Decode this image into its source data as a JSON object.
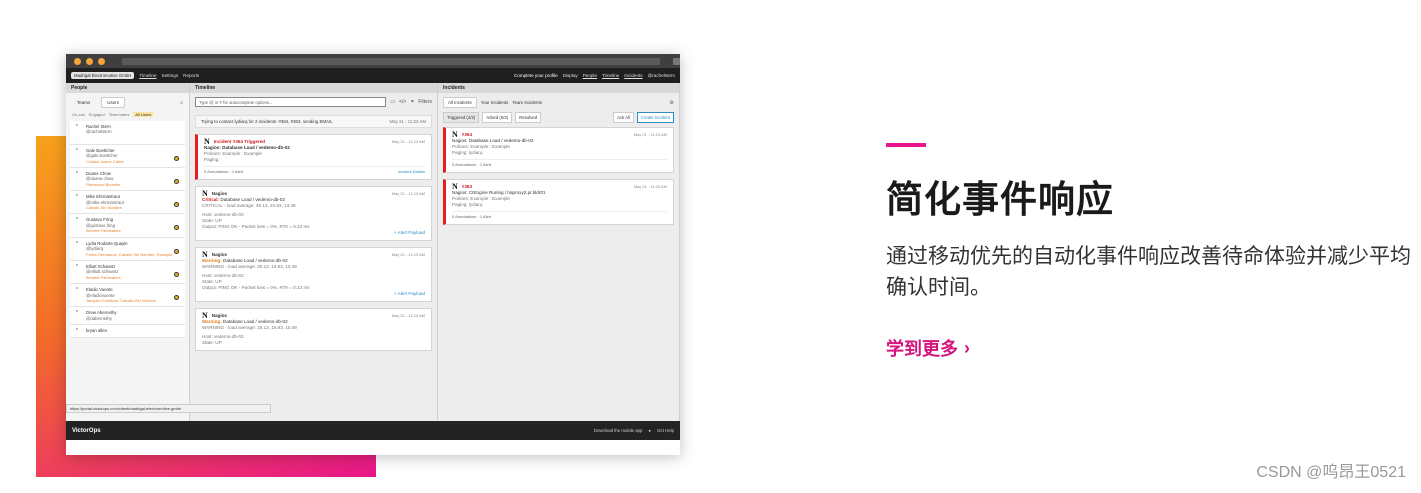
{
  "app": {
    "org_name": "Madrigal Electromotive GmbH",
    "nav": [
      "Timeline",
      "Settings",
      "Reports"
    ],
    "right_nav": [
      "Complete your profile",
      "Display",
      "People",
      "Timeline",
      "Incidents",
      "@rachelstern"
    ],
    "columns": {
      "people": "People",
      "timeline": "Timeline",
      "incidents": "Incidents"
    }
  },
  "people": {
    "tabs": [
      "Teams",
      "Users"
    ],
    "filters": [
      "On-call",
      "Engaged",
      "Teammates",
      "All Users"
    ],
    "list": [
      {
        "name": "Rachel Stern",
        "handle": "@rachelstern",
        "org": ""
      },
      {
        "name": "Gale Boettcher",
        "handle": "@gale.boettcher",
        "org": "Ciudad Juarez Cartel"
      },
      {
        "name": "Duane Chow",
        "handle": "@duane.chow",
        "org": "Fleetwood Bounder"
      },
      {
        "name": "Mike Ehrmantraut",
        "handle": "@mike.ehrmantraut",
        "org": "Caballo Sin Nombre"
      },
      {
        "name": "Gustavo Fring",
        "handle": "@gustavo.fring",
        "org": "Benekè Fabricators"
      },
      {
        "name": "Lydia Rodarte-Quayle",
        "handle": "@lydiarq",
        "org": "Pollos Hermanos, Caballo Sin Nombre, Example"
      },
      {
        "name": "Elliott Schwartz",
        "handle": "@elliott.schwartz",
        "org": "Benekè Fabricators"
      },
      {
        "name": "Eladio Vuente",
        "handle": "@eladiovuente",
        "org": "Tampico Furniture, Caballo Sin Nombre"
      },
      {
        "name": "Drew Abernethy",
        "handle": "@dabernethy",
        "org": ""
      },
      {
        "name": "bryan allen",
        "handle": "",
        "org": ""
      }
    ]
  },
  "timeline": {
    "search_placeholder": "Type @ or # for autocomplete options...",
    "filters_label": "Filters",
    "banner": {
      "text": "Trying to contact lydiarq for 2 incidents: #364, #363, sending EMAIL",
      "time": "May 21 - 11:23 AM"
    },
    "cards": [
      {
        "title": "Incident #364 Triggered",
        "title_kind": "red",
        "subtitle": "Nagios: Database Load / vedemo-db-02",
        "lines": [
          "Policies: Example : Example",
          "Paging:"
        ],
        "time": "May 21 - 11:23 AM",
        "annotations": "0 Annotations",
        "alerts": "1 Alert",
        "action": "Incident Details"
      },
      {
        "title": "Nagios",
        "status": "Critical:",
        "status_kind": "red",
        "subtitle": "Database Load / vedemo-db-02",
        "lines": [
          "CRITICAL - load average: 49.13, 24.93, 13.49",
          "Host: vedemo-db-02",
          "State: UP",
          "Output: PING OK - Packet loss = 0%, RTA = 0.23 ms"
        ],
        "time": "May 21 - 11:23 AM",
        "action": "+ Alert Payload"
      },
      {
        "title": "Nagios",
        "status": "Warning:",
        "status_kind": "orange",
        "subtitle": "Database Load / vedemo-db-02",
        "lines": [
          "WARNING - load average: 20.13, 15.93, 10.49",
          "Host: vedemo-db-02",
          "State: UP",
          "Output: PING OK - Packet loss = 0%, RTA = 0.23 ms"
        ],
        "time": "May 21 - 11:23 AM",
        "action": "+ Alert Payload"
      },
      {
        "title": "Nagios",
        "status": "Warning:",
        "status_kind": "orange",
        "subtitle": "Database Load / vedemo-db-02",
        "lines": [
          "WARNING - load average: 20.13, 15.93, 10.49",
          "Host: vedemo-db-02",
          "State: UP"
        ],
        "time": "May 21 - 11:23 AM",
        "action": ""
      }
    ]
  },
  "incidents": {
    "tabs": [
      "All Incidents",
      "Your Incidents",
      "Team Incidents"
    ],
    "subtabs": [
      "Triggered (2/2)",
      "Acked (0/2)",
      "Resolved"
    ],
    "ack_all": "Ack All",
    "create": "Create Incident",
    "list": [
      {
        "id": "#364",
        "summary": "Nagios: Database Load / vedemo-db-02",
        "policies": "Policies: Example : Example",
        "paging": "Paging: lydiarq",
        "time": "May 21 - 11:23 AM",
        "annotations": "0 Annotations",
        "alerts": "1 Alert"
      },
      {
        "id": "#363",
        "summary": "Nagios: CIEngine Runlog / haproxy2.pr.bldr01",
        "policies": "Policies: Example : Example",
        "paging": "Paging: lydiarq",
        "time": "May 21 - 11:20 AM",
        "annotations": "0 Annotations",
        "alerts": "1 Alert"
      }
    ]
  },
  "footer": {
    "brand": "VictorOps",
    "download": "Download the mobile app",
    "help": "Get Help",
    "status_url": "https://portal.victorops.com/client/madrigal-electromotive-gmbh"
  },
  "marketing": {
    "heading": "简化事件响应",
    "description": "通过移动优先的自动化事件响应改善待命体验并减少平均确认时间。",
    "cta": "学到更多",
    "accent_color": "#e8168a"
  },
  "watermark": "CSDN @呜昂王0521"
}
